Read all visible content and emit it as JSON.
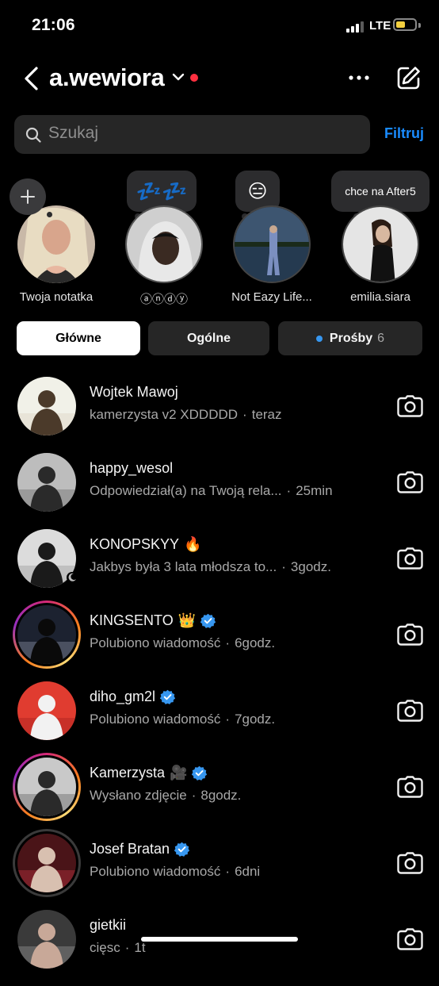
{
  "status_bar": {
    "time": "21:06",
    "network": "LTE"
  },
  "header": {
    "username": "a.wewiora"
  },
  "search": {
    "placeholder": "Szukaj",
    "filter_label": "Filtruj"
  },
  "notes": [
    {
      "name": "Twoja notatka",
      "bubble": ""
    },
    {
      "name": "ⓐⓝⓓⓨ",
      "bubble": "💤💤"
    },
    {
      "name": "Not Eazy Life...",
      "bubble": "😑"
    },
    {
      "name": "emilia.siara",
      "bubble": "chce na After5"
    }
  ],
  "tabs": [
    {
      "label": "Główne"
    },
    {
      "label": "Ogólne"
    },
    {
      "label": "Prośby",
      "count": "6"
    }
  ],
  "conversations": [
    {
      "name": "Wojtek Mawoj",
      "emoji": "",
      "verified": false,
      "message": "kamerzysta v2 XDDDDD",
      "time": "teraz"
    },
    {
      "name": "happy_wesol",
      "emoji": "",
      "verified": false,
      "message": "Odpowiedział(a) na Twoją rela...",
      "time": "25min"
    },
    {
      "name": "KONOPSKYY",
      "emoji": "🔥",
      "verified": false,
      "message": "Jakbys była 3 lata młodsza to...",
      "time": "3godz."
    },
    {
      "name": "KINGSENTO",
      "emoji": "👑",
      "verified": true,
      "message": "Polubiono wiadomość",
      "time": "6godz."
    },
    {
      "name": "diho_gm2l",
      "emoji": "",
      "verified": true,
      "message": "Polubiono wiadomość",
      "time": "7godz."
    },
    {
      "name": "Kamerzysta",
      "emoji": "🎥",
      "verified": true,
      "message": "Wysłano zdjęcie",
      "time": "8godz."
    },
    {
      "name": "Josef Bratan",
      "emoji": "",
      "verified": true,
      "message": "Polubiono wiadomość",
      "time": "6dni"
    },
    {
      "name": "gietkii",
      "emoji": "",
      "verified": false,
      "message": "cięsc",
      "time": "1t"
    }
  ],
  "colors": {
    "accent": "#1a8cff",
    "verified": "#3797f0",
    "live": "#ff3040"
  }
}
